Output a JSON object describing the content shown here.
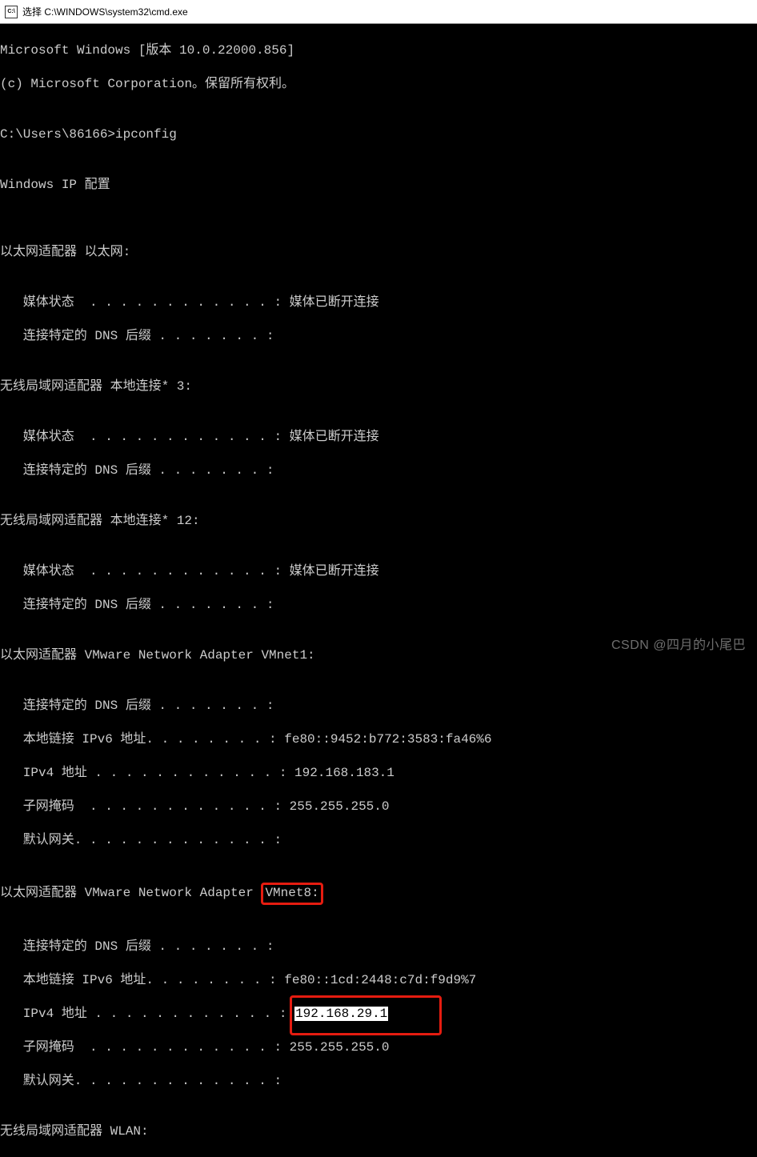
{
  "window": {
    "title": "选择 C:\\WINDOWS\\system32\\cmd.exe",
    "icon_label": "C:\\"
  },
  "lines": {
    "l0": "Microsoft Windows [版本 10.0.22000.856]",
    "l1": "(c) Microsoft Corporation。保留所有权利。",
    "l2": "",
    "l3": "C:\\Users\\86166>ipconfig",
    "l4": "",
    "l5": "Windows IP 配置",
    "l6": "",
    "l7": "",
    "l8": "以太网适配器 以太网:",
    "l9": "",
    "l10": "   媒体状态  . . . . . . . . . . . . : 媒体已断开连接",
    "l11": "   连接特定的 DNS 后缀 . . . . . . . :",
    "l12": "",
    "l13": "无线局域网适配器 本地连接* 3:",
    "l14": "",
    "l15": "   媒体状态  . . . . . . . . . . . . : 媒体已断开连接",
    "l16": "   连接特定的 DNS 后缀 . . . . . . . :",
    "l17": "",
    "l18": "无线局域网适配器 本地连接* 12:",
    "l19": "",
    "l20": "   媒体状态  . . . . . . . . . . . . : 媒体已断开连接",
    "l21": "   连接特定的 DNS 后缀 . . . . . . . :",
    "l22": "",
    "l23": "以太网适配器 VMware Network Adapter VMnet1:",
    "l24": "",
    "l25": "   连接特定的 DNS 后缀 . . . . . . . :",
    "l26": "   本地链接 IPv6 地址. . . . . . . . : fe80::9452:b772:3583:fa46%6",
    "l27": "   IPv4 地址 . . . . . . . . . . . . : 192.168.183.1",
    "l28": "   子网掩码  . . . . . . . . . . . . : 255.255.255.0",
    "l29": "   默认网关. . . . . . . . . . . . . :",
    "l30": "",
    "l31_prefix": "以太网适配器 VMware Network Adapter ",
    "l31_hl": "VMnet8:",
    "l32": "",
    "l33": "   连接特定的 DNS 后缀 . . . . . . . :",
    "l34": "   本地链接 IPv6 地址. . . . . . . . : fe80::1cd:2448:c7d:f9d9%7",
    "l35_prefix": "   IPv4 地址 . . . . . . . . . . . . : ",
    "l35_val": "192.168.29.1",
    "l36": "   子网掩码  . . . . . . . . . . . . : 255.255.255.0",
    "l37": "   默认网关. . . . . . . . . . . . . :",
    "l38": "",
    "l39": "无线局域网适配器 WLAN:"
  },
  "watermark": "CSDN @四月的小尾巴"
}
